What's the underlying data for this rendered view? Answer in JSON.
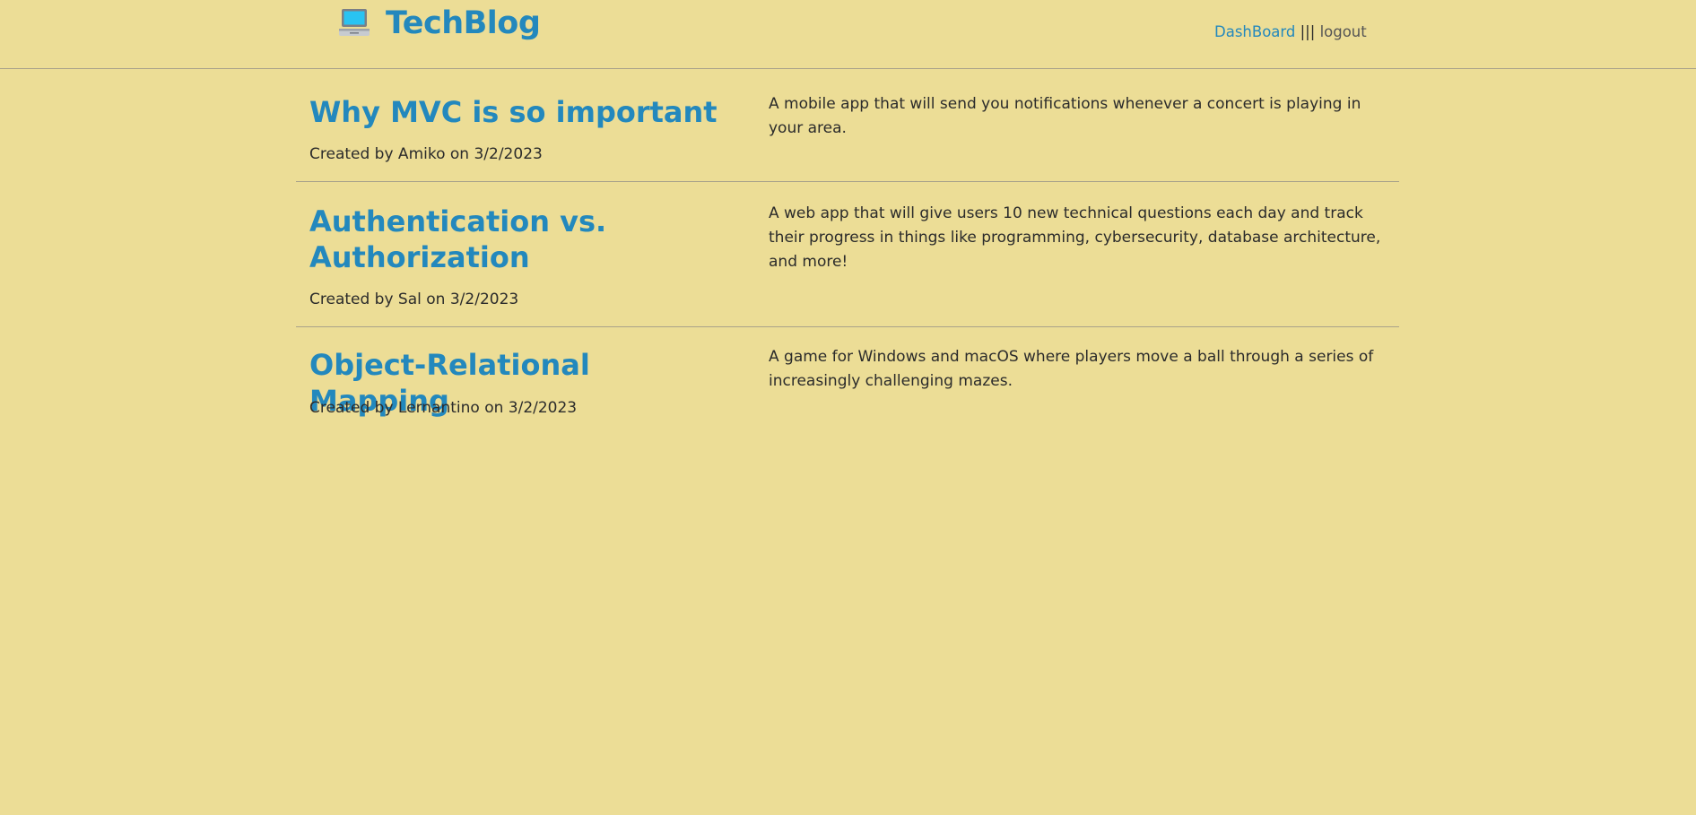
{
  "header": {
    "title": "TechBlog",
    "logo_icon": "laptop-icon",
    "nav": {
      "dashboard": "DashBoard",
      "separator": "|||",
      "logout": "logout"
    }
  },
  "posts": [
    {
      "title": "Why MVC is so important",
      "meta": "Created by Amiko on 3/2/2023",
      "description": "A mobile app that will send you notifications whenever a concert is playing in your area."
    },
    {
      "title": "Authentication vs. Authorization",
      "meta": "Created by Sal on 3/2/2023",
      "description": "A web app that will give users 10 new technical questions each day and track their progress in things like programming, cybersecurity, database architecture, and more!"
    },
    {
      "title": "Object-Relational Mapping",
      "meta": "Created by Lernantino on 3/2/2023",
      "description": "A game for Windows and macOS where players move a ball through a series of increasingly challenging mazes."
    }
  ],
  "colors": {
    "background": "#ecdd96",
    "accent": "#2388bd",
    "text": "#2b2b2b",
    "divider": "#a9a28a"
  }
}
